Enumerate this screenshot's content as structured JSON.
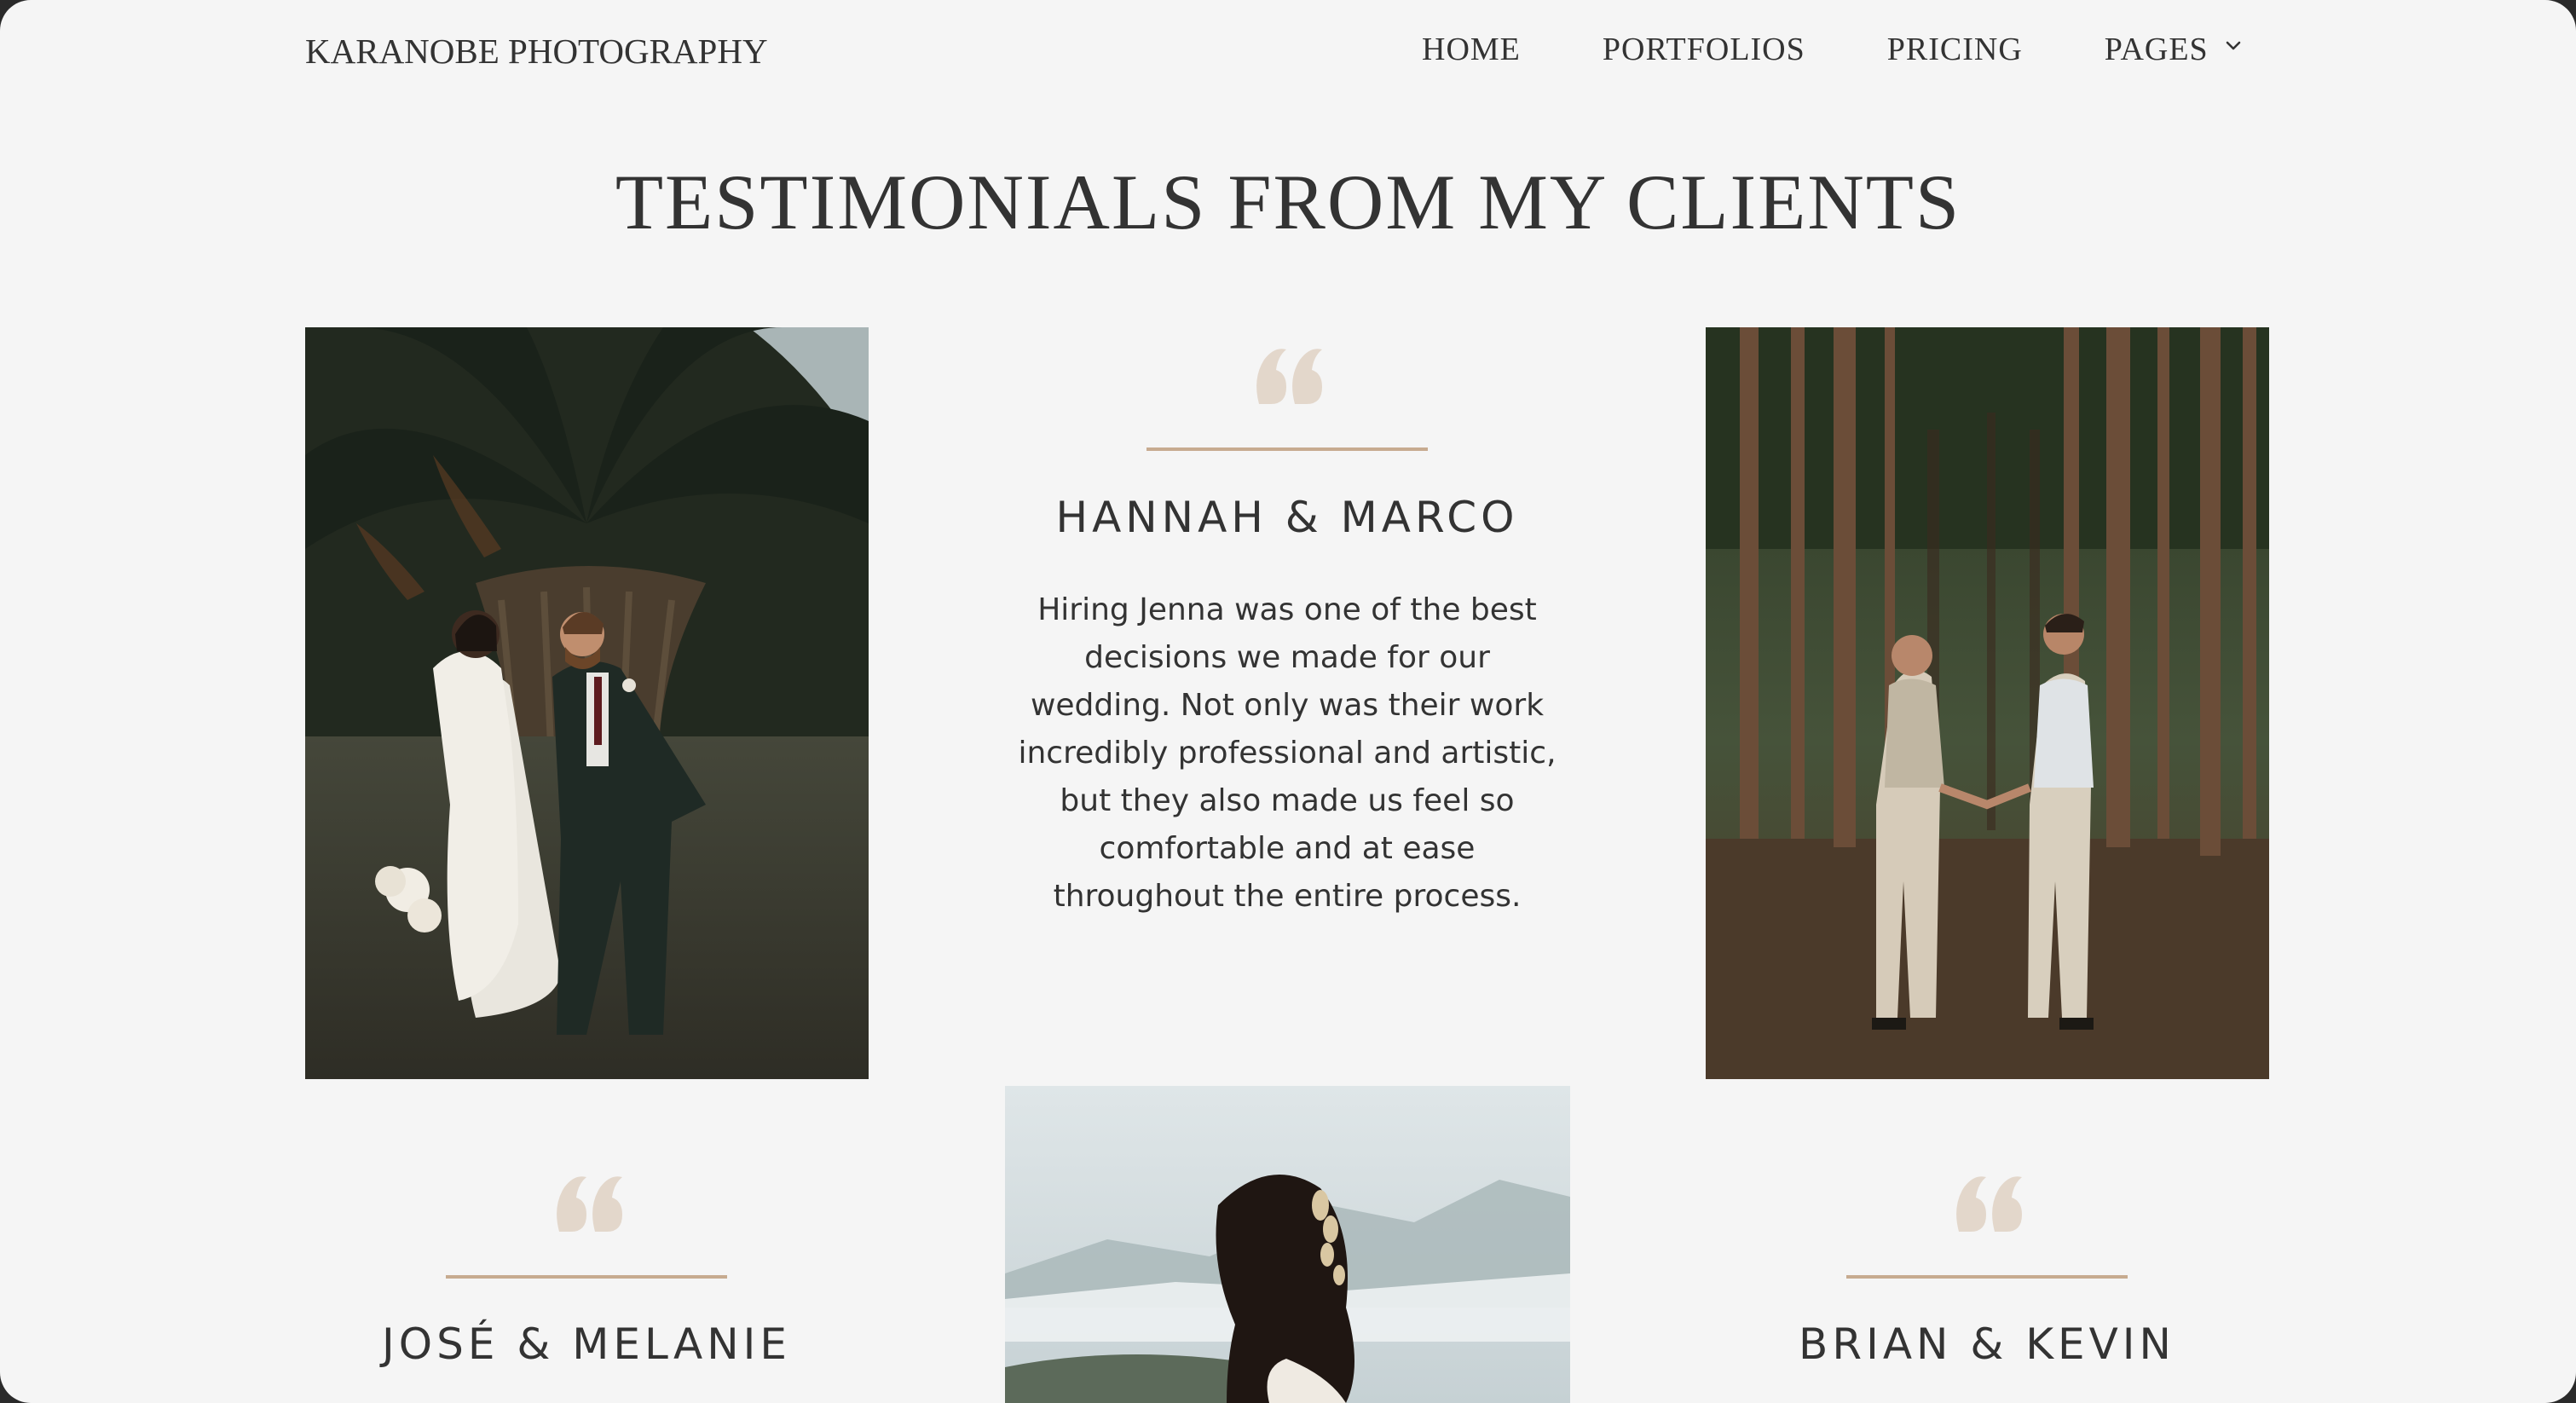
{
  "header": {
    "brand": "KARANOBE PHOTOGRAPHY",
    "nav": [
      {
        "label": "HOME"
      },
      {
        "label": "PORTFOLIOS"
      },
      {
        "label": "PRICING"
      },
      {
        "label": "PAGES"
      }
    ],
    "dropdown_icon": "chevron-down-icon"
  },
  "section": {
    "title": "TESTIMONIALS FROM MY CLIENTS"
  },
  "testimonials": [
    {
      "name": "HANNAH & MARCO",
      "quote_icon": "quote-icon",
      "text": "Hiring Jenna was one of the best decisions we made for our wedding. Not only was their work incredibly professional and artistic, but they also made us feel so comfortable and at ease throughout the entire process."
    },
    {
      "name": "JOSÉ & MELANIE",
      "quote_icon": "quote-icon"
    },
    {
      "name": "BRIAN & KEVIN",
      "quote_icon": "quote-icon"
    }
  ],
  "photos": [
    {
      "subject": "bride and groom walking under palm tree"
    },
    {
      "subject": "two grooms holding hands in a pine forest"
    },
    {
      "subject": "bride with hair ornament overlooking misty mountains"
    }
  ],
  "colors": {
    "background": "#f5f5f5",
    "text": "#333333",
    "accent": "#c7ab90",
    "quote": "#e3d7cb"
  }
}
